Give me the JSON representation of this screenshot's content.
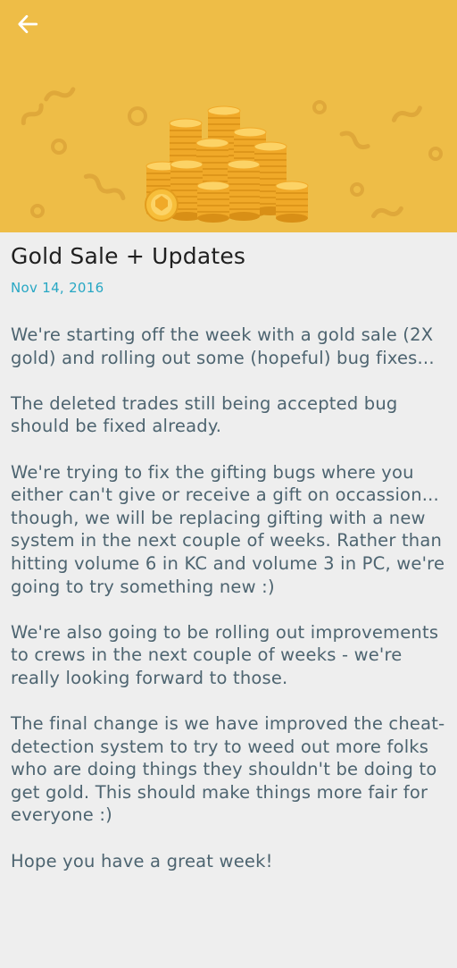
{
  "header": {
    "back_icon": "arrow-left-icon",
    "banner_image": "gold-coin-stacks-illustration",
    "banner_color": "#eebd47"
  },
  "article": {
    "title": "Gold Sale + Updates",
    "date": "Nov 14, 2016",
    "paragraphs": [
      "We're starting off the week with a gold sale (2X gold) and rolling out some (hopeful) bug fixes...",
      "The deleted trades still being accepted bug should be fixed already.",
      "We're trying to fix the gifting bugs where you either can't give or receive a gift on occassion... though, we will be replacing gifting with a new system in the next couple of weeks. Rather than hitting volume 6 in KC and volume 3 in PC, we're going to try something new :)",
      "We're also going to be rolling out improvements to crews in the next couple of weeks - we're really looking forward to those.",
      "The final change is we have improved the cheat-detection system to try to weed out more folks who are doing things they shouldn't be doing to get gold. This should make things more fair for everyone :)",
      "Hope you have a great week!"
    ]
  },
  "colors": {
    "title": "#1f1f1f",
    "date": "#27a7c4",
    "body_text": "#4d6470",
    "background": "#eeeeee"
  }
}
